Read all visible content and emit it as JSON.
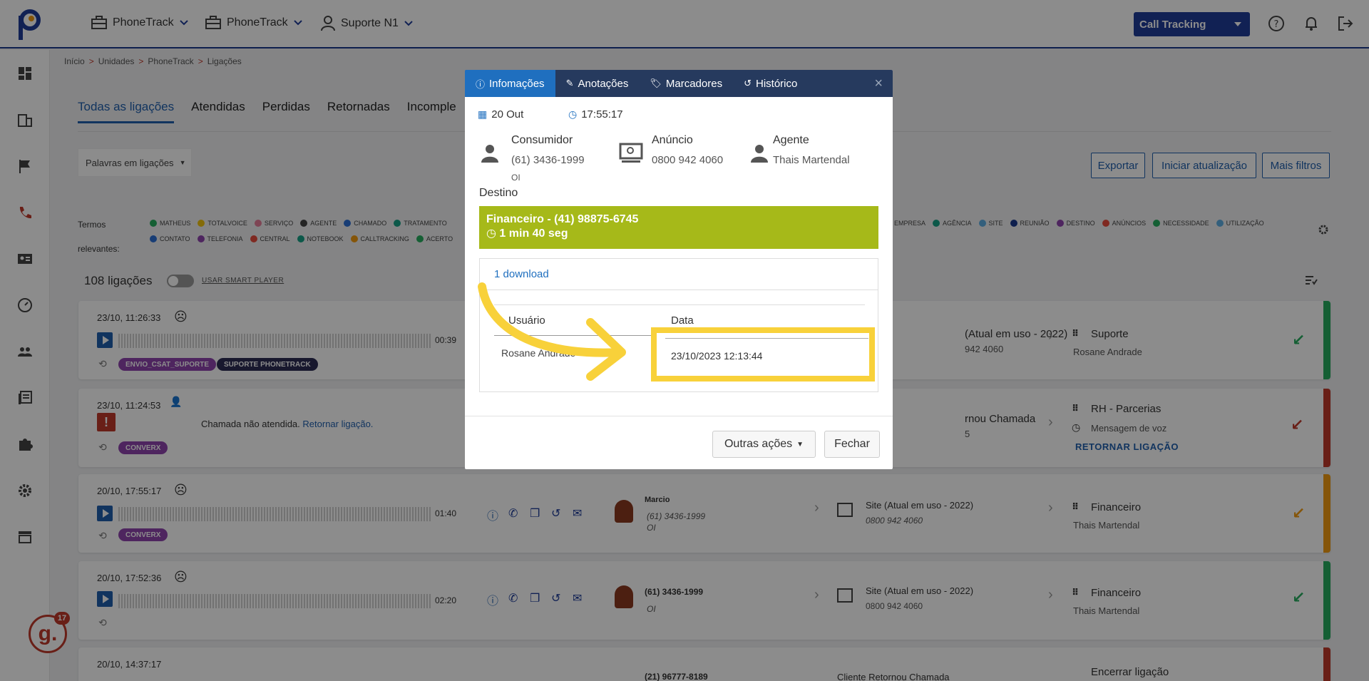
{
  "topbar": {
    "menus": [
      {
        "label": "PhoneTrack",
        "icon": "briefcase-icon"
      },
      {
        "label": "PhoneTrack",
        "icon": "briefcase-icon"
      },
      {
        "label": "Suporte N1",
        "icon": "user-icon"
      }
    ],
    "product_label": "Call Tracking"
  },
  "breadcrumb": [
    "Início",
    "Unidades",
    "PhoneTrack",
    "Ligações"
  ],
  "breadcrumb_sep": ">",
  "tabs": [
    "Todas as ligações",
    "Atendidas",
    "Perdidas",
    "Retornadas",
    "Incomple"
  ],
  "filter": {
    "label": "Palavras em ligações"
  },
  "actions": {
    "export": "Exportar",
    "start_update": "Iniciar atualização",
    "more_filters": "Mais filtros"
  },
  "terms_label": "Termos relevantes:",
  "terms_row1": [
    {
      "name": "MATHEUS",
      "color": "#27ae60"
    },
    {
      "name": "TOTALVOICE",
      "color": "#f1c40f"
    },
    {
      "name": "SERVIÇO",
      "color": "#e67e9a"
    },
    {
      "name": "AGENTE",
      "color": "#444444"
    },
    {
      "name": "CHAMADO",
      "color": "#2d6fd6"
    },
    {
      "name": "TRATAMENTO",
      "color": "#16a085"
    }
  ],
  "terms_row1_right": [
    {
      "name": "EMPRESA",
      "color": "#c0392b"
    },
    {
      "name": "AGÊNCIA",
      "color": "#16a085"
    },
    {
      "name": "SITE",
      "color": "#5dade2"
    },
    {
      "name": "REUNIÃO",
      "color": "#1a3a8f"
    },
    {
      "name": "DESTINO",
      "color": "#8e44ad"
    },
    {
      "name": "ANÚNCIOS",
      "color": "#e74c3c"
    },
    {
      "name": "NECESSIDADE",
      "color": "#27ae60"
    },
    {
      "name": "UTILIZAÇÃO",
      "color": "#5dade2"
    }
  ],
  "terms_row2": [
    {
      "name": "CONTATO",
      "color": "#2d6fd6"
    },
    {
      "name": "TELEFONIA",
      "color": "#8e44ad"
    },
    {
      "name": "CENTRAL",
      "color": "#e74c3c"
    },
    {
      "name": "NOTEBOOK",
      "color": "#16a085"
    },
    {
      "name": "CALLTRACKING",
      "color": "#f39c12"
    },
    {
      "name": "ACERTO",
      "color": "#27ae60"
    }
  ],
  "list": {
    "count": "108 ligações",
    "smart_player": "USAR SMART PLAYER"
  },
  "calls": [
    {
      "time": "23/10, 11:26:33",
      "duration": "00:39",
      "tags": [
        "ENVIO_CSAT_SUPORTE",
        "SUPORTE PHONETRACK"
      ],
      "dest_title": "(Atual em uso - 2022)",
      "dest_phone": "942 4060",
      "queue": "Suporte",
      "agent": "Rosane Andrade",
      "bar_color": "#27ae60"
    },
    {
      "time": "23/10, 11:24:53",
      "message": "Chamada não atendida.",
      "message_link": "Retornar ligação.",
      "tags": [
        "CONVERX"
      ],
      "dest_title": "rnou Chamada",
      "dest_phone": "5",
      "queue": "RH - Parcerias",
      "agent": "Mensagem de voz",
      "link": "RETORNAR LIGAÇÃO",
      "bar_color": "#c0392b"
    },
    {
      "time": "20/10, 17:55:17",
      "duration": "01:40",
      "tags": [
        "CONVERX"
      ],
      "caller": "Marcio",
      "caller_phone": "(61) 3436-1999",
      "caller_op": "OI",
      "dest_title": "Site (Atual em uso - 2022)",
      "dest_phone": "0800 942 4060",
      "queue": "Financeiro",
      "agent": "Thais Martendal",
      "bar_color": "#f39c12"
    },
    {
      "time": "20/10, 17:52:36",
      "duration": "02:20",
      "caller": "(61) 3436-1999",
      "caller_op": "OI",
      "dest_title": "Site (Atual em uso - 2022)",
      "dest_phone": "0800 942 4060",
      "queue": "Financeiro",
      "agent": "Thais Martendal",
      "bar_color": "#27ae60"
    },
    {
      "time": "20/10, 14:37:17",
      "caller": "(21) 96777-8189",
      "dest_title": "Cliente Retornou Chamada",
      "queue": "Encerrar ligação",
      "bar_color": "#c0392b"
    }
  ],
  "modal": {
    "tabs": [
      "Infomações",
      "Anotações",
      "Marcadores",
      "Histórico"
    ],
    "date": "20 Out",
    "time": "17:55:17",
    "consumer_label": "Consumidor",
    "consumer_phone": "(61) 3436-1999",
    "consumer_op": "OI",
    "ad_label": "Anúncio",
    "ad_phone": "0800 942 4060",
    "agent_label": "Agente",
    "agent_name": "Thais Martendal",
    "dest_label": "Destino",
    "dest_value": "Financeiro - (41) 98875-6745",
    "dest_duration": "1 min 40 seg",
    "downloads_title": "1 download",
    "col_user": "Usuário",
    "col_date": "Data",
    "row_user": "Rosane Andrade",
    "row_date": "23/10/2023 12:13:44",
    "btn_more": "Outras ações",
    "btn_close": "Fechar"
  },
  "badge": {
    "letter": "g.",
    "count": "17"
  },
  "colors": {
    "accent": "#1f3d99",
    "highlight": "#f8d13a",
    "dest_box": "#a6b919"
  }
}
